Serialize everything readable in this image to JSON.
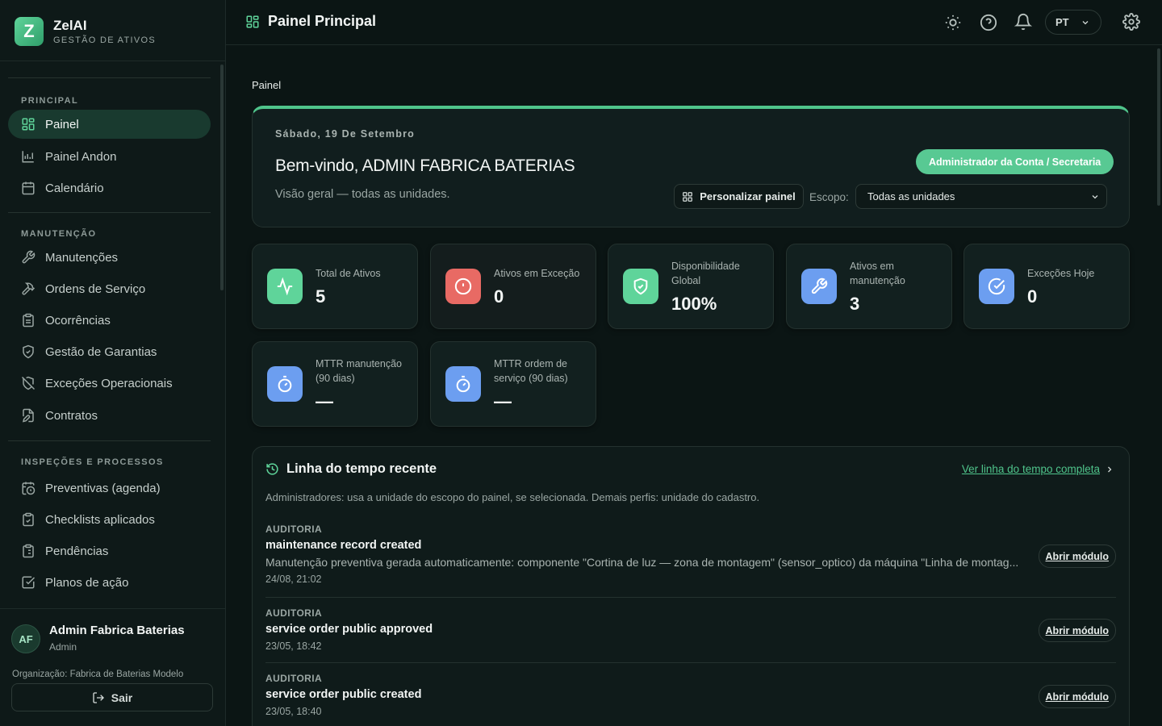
{
  "brand": {
    "name": "ZelAI",
    "subtitle": "GESTÃO DE ATIVOS",
    "logo_letter": "Z"
  },
  "sidebar": {
    "sections": [
      {
        "title": "PRINCIPAL",
        "items": [
          {
            "label": "Painel",
            "icon": "dashboard-icon",
            "active": true
          },
          {
            "label": "Painel Andon",
            "icon": "andon-chart-icon"
          },
          {
            "label": "Calendário",
            "icon": "calendar-icon"
          }
        ]
      },
      {
        "title": "MANUTENÇÃO",
        "items": [
          {
            "label": "Manutenções",
            "icon": "wrench-icon"
          },
          {
            "label": "Ordens de Serviço",
            "icon": "hammer-icon"
          },
          {
            "label": "Ocorrências",
            "icon": "clipboard-icon"
          },
          {
            "label": "Gestão de Garantias",
            "icon": "shield-check-icon"
          },
          {
            "label": "Exceções Operacionais",
            "icon": "shield-off-icon"
          },
          {
            "label": "Contratos",
            "icon": "file-edit-icon"
          }
        ]
      },
      {
        "title": "INSPEÇÕES E PROCESSOS",
        "items": [
          {
            "label": "Preventivas (agenda)",
            "icon": "calendar-clock-icon"
          },
          {
            "label": "Checklists aplicados",
            "icon": "clipboard-check-icon"
          },
          {
            "label": "Pendências",
            "icon": "clipboard-list-icon"
          },
          {
            "label": "Planos de ação",
            "icon": "checkbox-icon"
          }
        ]
      }
    ]
  },
  "user": {
    "initials": "AF",
    "name": "Admin Fabrica Baterias",
    "role": "Admin",
    "org": "Organização: Fabrica de Baterias Modelo",
    "logout_label": "Sair"
  },
  "header": {
    "title": "Painel Principal",
    "language": "PT"
  },
  "breadcrumb": "Painel",
  "welcome": {
    "date": "Sábado, 19 De Setembro",
    "title": "Bem-vindo, ADMIN FABRICA BATERIAS",
    "subtitle": "Visão geral — todas as unidades.",
    "role_badge": "Administrador da Conta / Secretaria",
    "customize_label": "Personalizar painel",
    "scope_label": "Escopo:",
    "scope_value": "Todas as unidades"
  },
  "kpis": [
    {
      "label": "Total de Ativos",
      "value": "5",
      "icon": "activity-icon",
      "color": "#5fd49a"
    },
    {
      "label": "Ativos em Exceção",
      "value": "0",
      "icon": "alert-circle-icon",
      "color": "#e86a64"
    },
    {
      "label": "Disponibilidade Global",
      "value": "100%",
      "icon": "shield-check-icon",
      "color": "#5fd49a"
    },
    {
      "label": "Ativos em manutenção",
      "value": "3",
      "icon": "wrench-icon",
      "color": "#6c9ef0"
    },
    {
      "label": "Exceções Hoje",
      "value": "0",
      "icon": "check-circle-icon",
      "color": "#6c9ef0"
    },
    {
      "label": "MTTR manutenção (90 dias)",
      "value": "—",
      "icon": "timer-icon",
      "color": "#6c9ef0"
    },
    {
      "label": "MTTR ordem de serviço (90 dias)",
      "value": "—",
      "icon": "timer-icon",
      "color": "#6c9ef0"
    }
  ],
  "timeline": {
    "title": "Linha do tempo recente",
    "link_label": "Ver linha do tempo completa",
    "description": "Administradores: usa a unidade do escopo do painel, se selecionada. Demais perfis: unidade do cadastro.",
    "open_label": "Abrir módulo",
    "items": [
      {
        "category": "AUDITORIA",
        "title": "maintenance record created",
        "body": "Manutenção preventiva gerada automaticamente: componente \"Cortina de luz — zona de montagem\" (sensor_optico) da máquina \"Linha de montag...",
        "time": "24/08, 21:02"
      },
      {
        "category": "AUDITORIA",
        "title": "service order public approved",
        "body": "",
        "time": "23/05, 18:42"
      },
      {
        "category": "AUDITORIA",
        "title": "service order public created",
        "body": "",
        "time": "23/05, 18:40"
      }
    ]
  }
}
